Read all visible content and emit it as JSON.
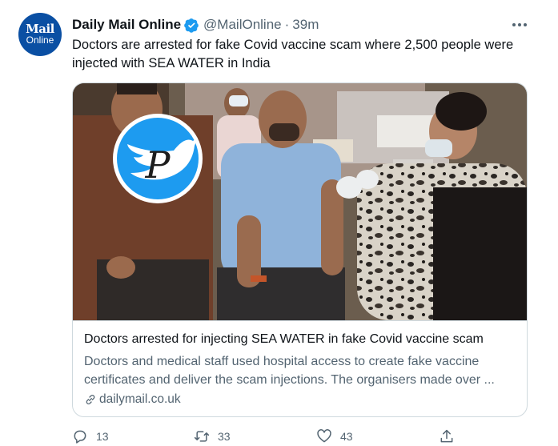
{
  "tweet": {
    "author": {
      "name": "Daily Mail Online",
      "handle": "@MailOnline",
      "separator": "·",
      "time": "39m",
      "avatar_line1": "Mail",
      "avatar_line2": "Online",
      "verified": true
    },
    "text": "Doctors are arrested for fake Covid vaccine scam where 2,500 people were injected with SEA WATER in India",
    "card": {
      "title": "Doctors arrested for injecting SEA WATER in fake Covid vaccine scam",
      "description": "Doctors and medical staff used hospital access to create fake vaccine certificates and deliver the scam injections. The organisers made over ...",
      "domain": "dailymail.co.uk",
      "image_watermark": "P"
    },
    "actions": {
      "reply_count": "13",
      "retweet_count": "33",
      "like_count": "43"
    }
  },
  "colors": {
    "verified": "#1d9bf0",
    "text_primary": "#0f1419",
    "text_secondary": "#536471",
    "border": "#cfd9de",
    "avatar_bg": "#0a4fa3"
  }
}
